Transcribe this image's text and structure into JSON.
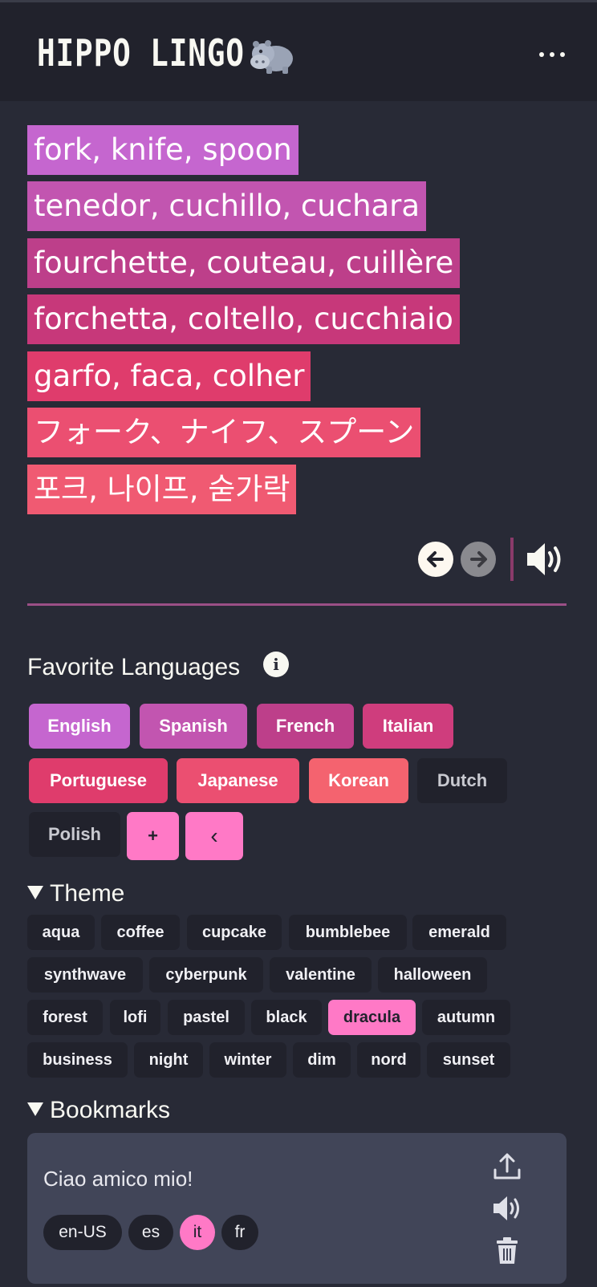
{
  "app": {
    "title": "HIPPO LINGO",
    "logo_icon": "hippo-icon",
    "menu_icon": "more-horizontal-icon"
  },
  "phrases": [
    {
      "text": "fork, knife, spoon",
      "color": "#c566cf"
    },
    {
      "text": "tenedor, cuchillo, cuchara",
      "color": "#c255b0"
    },
    {
      "text": "fourchette, couteau, cuillère",
      "color": "#bd3f8a"
    },
    {
      "text": "forchetta, coltello, cucchiaio",
      "color": "#c7387a"
    },
    {
      "text": "garfo, faca, colher",
      "color": "#df3c6c"
    },
    {
      "text": "フォーク、ナイフ、スプーン",
      "color": "#eb4f71"
    },
    {
      "text": "포크, 나이프, 숟가락",
      "color": "#f05a72"
    }
  ],
  "controls": {
    "prev_icon": "arrow-left-icon",
    "next_icon": "arrow-right-icon",
    "speak_icon": "speaker-icon"
  },
  "favorites": {
    "title": "Favorite Languages",
    "info_icon": "info-icon",
    "info_glyph": "i",
    "languages": [
      {
        "label": "English",
        "color": "#c566cf",
        "selected": true
      },
      {
        "label": "Spanish",
        "color": "#c255b0",
        "selected": true
      },
      {
        "label": "French",
        "color": "#bd3f8a",
        "selected": true
      },
      {
        "label": "Italian",
        "color": "#cf3d7d",
        "selected": true
      },
      {
        "label": "Portuguese",
        "color": "#df3c6c",
        "selected": true
      },
      {
        "label": "Japanese",
        "color": "#eb4f71",
        "selected": true
      },
      {
        "label": "Korean",
        "color": "#f4636f",
        "selected": true
      },
      {
        "label": "Dutch",
        "selected": false
      },
      {
        "label": "Polish",
        "selected": false
      }
    ],
    "add_label": "+",
    "collapse_label": "‹",
    "button_color": "#ff79c6"
  },
  "theme": {
    "title": "Theme",
    "options": [
      "aqua",
      "coffee",
      "cupcake",
      "bumblebee",
      "emerald",
      "synthwave",
      "cyberpunk",
      "valentine",
      "halloween",
      "forest",
      "lofi",
      "pastel",
      "black",
      "dracula",
      "autumn",
      "business",
      "night",
      "winter",
      "dim",
      "nord",
      "sunset"
    ],
    "selected": "dracula"
  },
  "bookmarks": {
    "title": "Bookmarks",
    "items": [
      {
        "text": "Ciao amico mio!",
        "langs": [
          "en-US",
          "es",
          "it",
          "fr"
        ],
        "active_lang": "it",
        "icons": [
          "share-icon",
          "speaker-icon",
          "trash-icon"
        ]
      }
    ]
  },
  "colors": {
    "background": "#282a36",
    "header": "#21222c",
    "accent": "#ff79c6"
  }
}
